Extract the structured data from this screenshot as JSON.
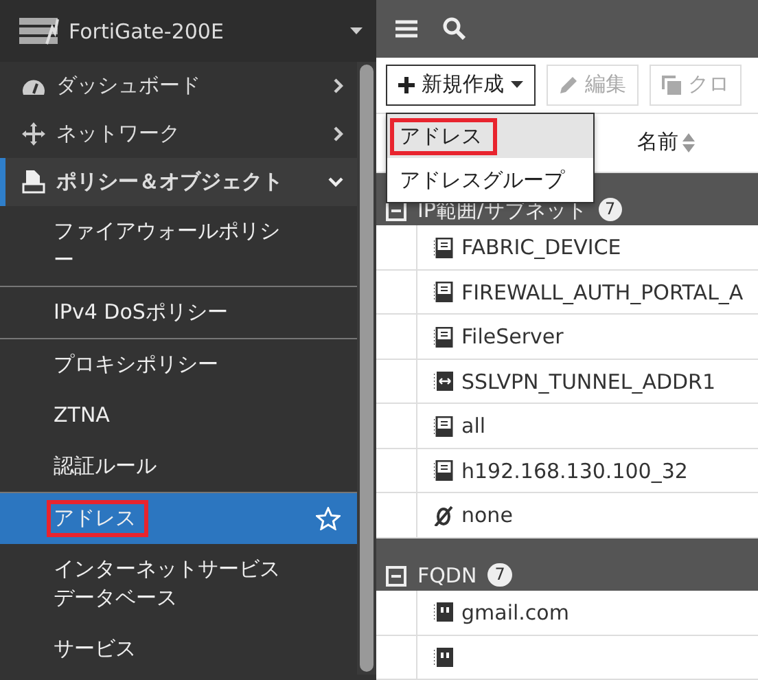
{
  "device": {
    "name": "FortiGate-200E"
  },
  "sidebar": {
    "items": [
      {
        "kind": "dashboard",
        "label": "ダッシュボード",
        "expanded": false
      },
      {
        "kind": "network",
        "label": "ネットワーク",
        "expanded": false
      },
      {
        "kind": "policy",
        "label": "ポリシー＆オブジェクト",
        "expanded": true,
        "children": [
          {
            "label": "ファイアウォールポリシー",
            "selected": false,
            "favorite": false,
            "highlighted": false,
            "divider": true
          },
          {
            "label": "IPv4 DoSポリシー",
            "selected": false,
            "favorite": false,
            "highlighted": false,
            "divider": true
          },
          {
            "label": "プロキシポリシー",
            "selected": false,
            "favorite": false,
            "highlighted": false,
            "divider": false
          },
          {
            "label": "ZTNA",
            "selected": false,
            "favorite": false,
            "highlighted": false,
            "divider": false
          },
          {
            "label": "認証ルール",
            "selected": false,
            "favorite": false,
            "highlighted": false,
            "divider": true
          },
          {
            "label": "アドレス",
            "selected": true,
            "favorite": true,
            "highlighted": true,
            "divider": false
          },
          {
            "label": "インターネットサービスデータベース",
            "selected": false,
            "favorite": false,
            "highlighted": false,
            "divider": false
          },
          {
            "label": "サービス",
            "selected": false,
            "favorite": false,
            "highlighted": false,
            "divider": false
          }
        ]
      }
    ]
  },
  "toolbar": {
    "buttons": [
      {
        "kind": "create",
        "label": "新規作成",
        "disabled": false
      },
      {
        "kind": "edit",
        "label": "編集",
        "disabled": true
      },
      {
        "kind": "clone",
        "label": "クロ",
        "disabled": true
      }
    ]
  },
  "dropdown": {
    "items": [
      {
        "label": "アドレス",
        "highlighted": true
      },
      {
        "label": "アドレスグループ",
        "highlighted": false
      }
    ]
  },
  "table": {
    "columns": [
      "名前"
    ],
    "groups": [
      {
        "label": "IP範囲/サブネット",
        "count": "7",
        "expanded": true,
        "rows": [
          {
            "kind": "address",
            "name": "FABRIC_DEVICE"
          },
          {
            "kind": "address",
            "name": "FIREWALL_AUTH_PORTAL_A"
          },
          {
            "kind": "address",
            "name": "FileServer"
          },
          {
            "kind": "range",
            "name": "SSLVPN_TUNNEL_ADDR1"
          },
          {
            "kind": "address",
            "name": "all"
          },
          {
            "kind": "address",
            "name": "h192.168.130.100_32"
          },
          {
            "kind": "none",
            "name": "none"
          }
        ]
      },
      {
        "label": "FQDN",
        "count": "7",
        "expanded": true,
        "rows": [
          {
            "kind": "fqdn",
            "name": "gmail.com"
          },
          {
            "kind": "fqdn",
            "name": ""
          }
        ]
      }
    ]
  }
}
